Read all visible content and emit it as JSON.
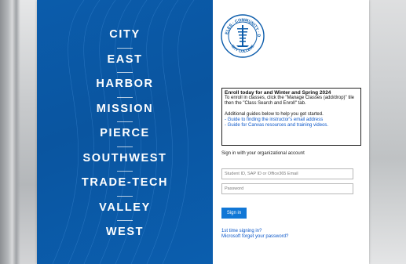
{
  "colleges": [
    "CITY",
    "EAST",
    "HARBOR",
    "MISSION",
    "PIERCE",
    "SOUTHWEST",
    "TRADE-TECH",
    "VALLEY",
    "WEST"
  ],
  "seal": {
    "top_text": "LOS ANGELES",
    "left_text": "COMMUNITY",
    "right_text": "DISTRICT",
    "bottom_text": "CITY COLLEGE"
  },
  "notice": {
    "title": "Enroll today for and Winter and Spring 2024",
    "instructions": "To enroll in classes, click the \"Manage Classes (add/drop)\" tile then the \"Class Search and Enroll\" tab.",
    "guides_intro": "Additional guides below to help you get started.",
    "links": [
      "- Guide to finding the instructor's email address",
      "- Guide for Canvas resources and training videos."
    ]
  },
  "signin": {
    "label": "Sign in with your organizational account",
    "username_placeholder": "Student ID, SAP ID or Office365 Email",
    "password_placeholder": "Password",
    "button_label": "Sign in",
    "first_time_link": "1st time signing in?",
    "forgot_link": "Microsoft forget your password?"
  },
  "colors": {
    "brand_blue": "#0b5cab",
    "link_blue": "#0b57c9",
    "button_blue": "#1177d6"
  }
}
